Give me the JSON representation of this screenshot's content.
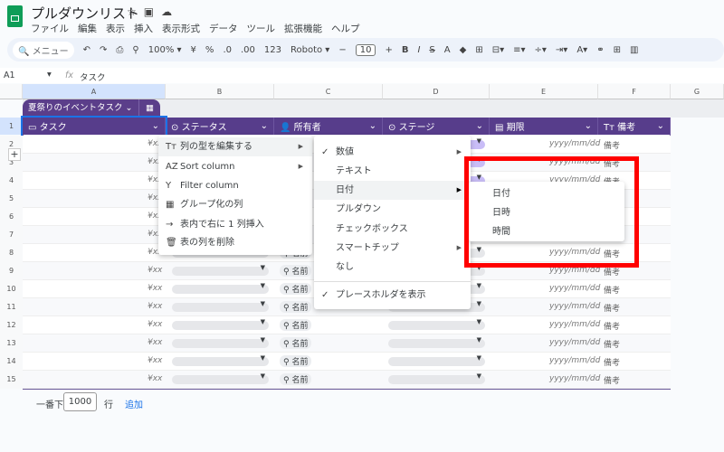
{
  "app": {
    "title": "プルダウンリスト",
    "menu": [
      "ファイル",
      "編集",
      "表示",
      "挿入",
      "表示形式",
      "データ",
      "ツール",
      "拡張機能",
      "ヘルプ"
    ]
  },
  "toolbar": {
    "search": "メニュー",
    "zoom": "100%",
    "currency": "¥",
    "percent": "%",
    "dec_minus": ".0",
    "dec_plus": ".00",
    "format123": "123",
    "font": "Roboto",
    "font_size": "10",
    "bold": "B",
    "italic": "I",
    "text_color": "A"
  },
  "formula_bar": {
    "cell_ref": "A1",
    "fx": "fx",
    "value": "タスク"
  },
  "columns": [
    "A",
    "B",
    "C",
    "D",
    "E",
    "F",
    "G"
  ],
  "table": {
    "name": "夏祭りのイベントタスク",
    "headers": [
      "タスク",
      "ステータス",
      "所有者",
      "ステージ",
      "期限",
      "備考"
    ],
    "row_numbers": [
      "1",
      "2",
      "3",
      "4",
      "5",
      "6",
      "7",
      "8",
      "9",
      "10",
      "11",
      "12",
      "13",
      "14",
      "15"
    ],
    "placeholder_amount": "¥xx",
    "placeholder_owner": "名前",
    "placeholder_date": "yyyy/mm/dd",
    "placeholder_note": "備考"
  },
  "context_menu": {
    "items": [
      "列の型を編集する",
      "Sort column",
      "Filter column",
      "グループ化の列",
      "表内で右に 1 列挿入",
      "表の列を削除"
    ]
  },
  "type_menu": {
    "items": [
      "数値",
      "テキスト",
      "日付",
      "プルダウン",
      "チェックボックス",
      "スマートチップ",
      "なし"
    ],
    "placeholder_toggle": "プレースホルダを表示"
  },
  "date_menu": {
    "items": [
      "日付",
      "日時",
      "時間"
    ]
  },
  "footer": {
    "prefix": "一番下に",
    "rows": "1000",
    "unit": "行",
    "add": "追加"
  },
  "colors": {
    "header": "#573d8b",
    "highlight": "#ff0000",
    "chip_purple": "#c9bdf7"
  }
}
